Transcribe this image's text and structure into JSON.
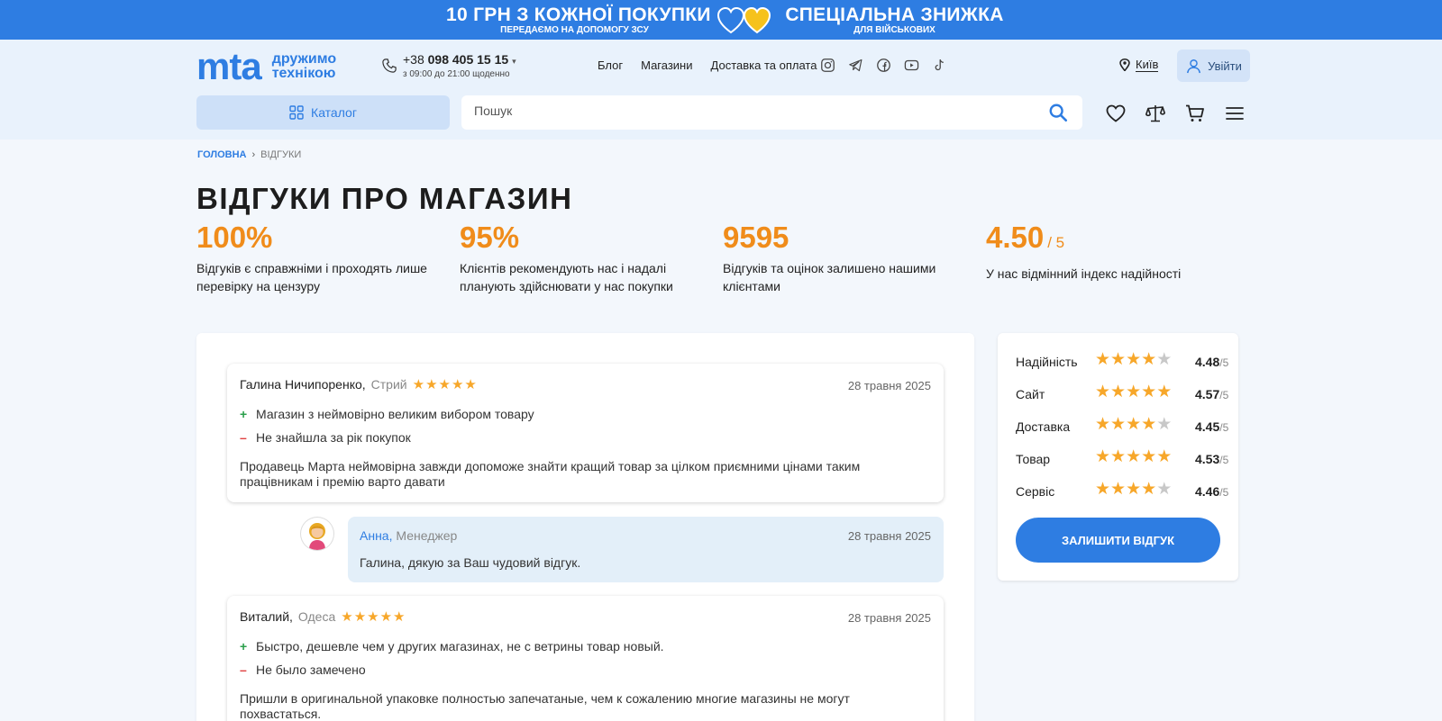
{
  "promo": {
    "left_title": "10 ГРН З КОЖНОЇ ПОКУПКИ",
    "left_sub": "ПЕРЕДАЄМО НА ДОПОМОГУ ЗСУ",
    "right_title": "СПЕЦІАЛЬНА ЗНИЖКА",
    "right_sub": "ДЛЯ ВІЙСЬКОВИХ",
    "colors": {
      "bg": "#2e7de2",
      "heart_blue": "#2e7de2",
      "heart_yellow": "#f6c21c"
    }
  },
  "header": {
    "logo_mark": "mta",
    "logo_tag_1": "дружимо",
    "logo_tag_2": "технікою",
    "phone_prefix": "+38",
    "phone_number": "098 405 15 15",
    "phone_hours": "з 09:00 до 21:00 щоденно",
    "nav": [
      "Блог",
      "Магазини",
      "Доставка та оплата"
    ],
    "social": [
      "instagram-icon",
      "telegram-icon",
      "facebook-icon",
      "youtube-icon",
      "tiktok-icon"
    ],
    "city": "Київ",
    "login": "Увійти",
    "catalog": "Каталог",
    "search_placeholder": "Пошук",
    "accent": "#2e7de2"
  },
  "breadcrumb": {
    "home": "ГОЛОВНА",
    "current": "ВІДГУКИ"
  },
  "page_title": "ВІДГУКИ ПРО МАГАЗИН",
  "stats": [
    {
      "value": "100%",
      "suffix": "",
      "desc": "Відгуків є справжніми і проходять лише перевірку на цензуру"
    },
    {
      "value": "95%",
      "suffix": "",
      "desc": "Клієнтів рекомендують нас і надалі планують здійснювати у нас покупки"
    },
    {
      "value": "9595",
      "suffix": "",
      "desc": "Відгуків та оцінок залишено нашими клієнтами"
    },
    {
      "value": "4.50",
      "suffix": "/ 5",
      "desc": "У нас відмінний індекс надійності"
    }
  ],
  "reviews": [
    {
      "author": "Галина Ничипоренко,",
      "city": "Стрий",
      "stars": 5,
      "date": "28 травня 2025",
      "plus": "Магазин з неймовірно великим вибором товару",
      "minus": "Не знайшла за рік покупок",
      "text": "Продавець Марта неймовірна завжди допоможе знайти кращий товар за цілком приємними цінами таким працівникам і премію варто давати",
      "reply": {
        "name": "Анна,",
        "role": "Менеджер",
        "date": "28 травня 2025",
        "text": "Галина, дякую за Ваш чудовий відгук."
      }
    },
    {
      "author": "Виталий,",
      "city": "Одеса",
      "stars": 5,
      "date": "28 травня 2025",
      "plus": "Быстро, дешевле чем у других магазинах, не с ветрины товар новый.",
      "minus": "Не было замечено",
      "text": "Пришли в оригинальной упаковке полностью запечатаные, чем к сожалению многие магазины не могут похвастаться."
    }
  ],
  "ratings": {
    "items": [
      {
        "label": "Надійність",
        "value": "4.48",
        "stars": 4
      },
      {
        "label": "Сайт",
        "value": "4.57",
        "stars": 5
      },
      {
        "label": "Доставка",
        "value": "4.45",
        "stars": 4
      },
      {
        "label": "Товар",
        "value": "4.53",
        "stars": 5
      },
      {
        "label": "Сервіс",
        "value": "4.46",
        "stars": 4
      }
    ],
    "max": "/5",
    "button": "ЗАЛИШИТИ ВІДГУК",
    "star_color": "#f7a72a"
  }
}
